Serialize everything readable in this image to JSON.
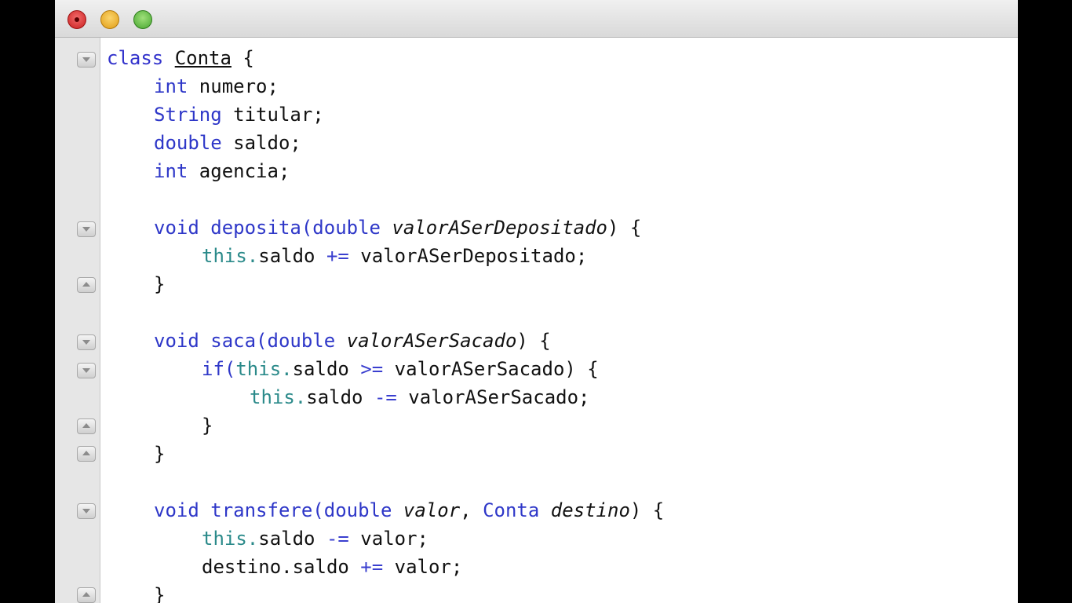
{
  "window": {
    "traffic_lights": [
      "close",
      "minimize",
      "zoom"
    ]
  },
  "colors": {
    "keyword": "#2e37c8",
    "this": "#2b8a8a",
    "text": "#111111"
  },
  "code": {
    "l1": {
      "kw": "class",
      "name": "Conta",
      "brace": " {"
    },
    "l2": {
      "kw": "int",
      "rest": " numero;"
    },
    "l3": {
      "kw": "String",
      "rest": " titular;"
    },
    "l4": {
      "kw": "double",
      "rest": " saldo;"
    },
    "l5": {
      "kw": "int",
      "rest": " agencia;"
    },
    "l6": {
      "kw": "void",
      "method": " deposita(",
      "ptype": "double",
      "param": " valorASerDepositado",
      "end": ") {"
    },
    "l7": {
      "this": "this.",
      "field": "saldo ",
      "op": "+=",
      "rest": " valorASerDepositado;"
    },
    "l8": {
      "text": "}"
    },
    "l9": {
      "kw": "void",
      "method": " saca(",
      "ptype": "double",
      "param": " valorASerSacado",
      "end": ") {"
    },
    "l10": {
      "kw": "if(",
      "this": "this.",
      "field": "saldo ",
      "op": ">=",
      "rest": " valorASerSacado) {"
    },
    "l11": {
      "this": "this.",
      "field": "saldo ",
      "op": "-=",
      "rest": " valorASerSacado;"
    },
    "l12": {
      "text": "}"
    },
    "l13": {
      "text": "}"
    },
    "l14": {
      "kw": "void",
      "method": " transfere(",
      "ptype": "double",
      "param": " valor",
      "sep": ", ",
      "ptype2": "Conta",
      "param2": " destino",
      "end": ") {"
    },
    "l15": {
      "this": "this.",
      "field": "saldo ",
      "op": "-=",
      "rest": " valor;"
    },
    "l16": {
      "field": "destino.saldo ",
      "op": "+=",
      "rest": " valor;"
    },
    "l17": {
      "text": "}"
    }
  }
}
